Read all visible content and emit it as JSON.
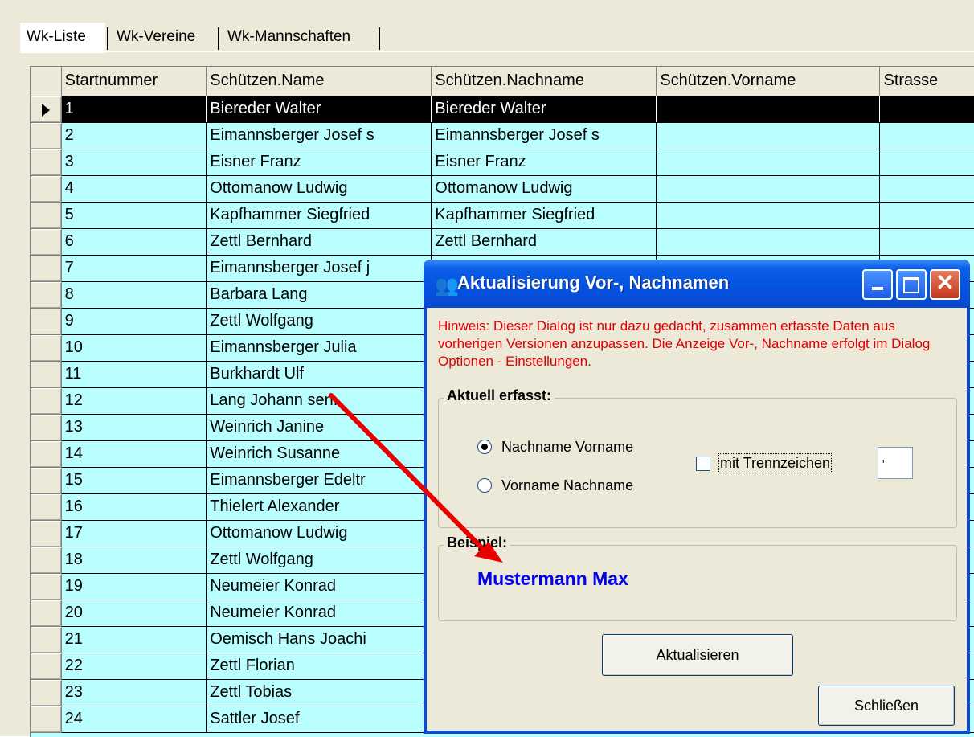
{
  "tabs": [
    "Wk-Liste",
    "Wk-Vereine",
    "Wk-Mannschaften"
  ],
  "grid": {
    "columns": [
      "Startnummer",
      "Schützen.Name",
      "Schützen.Nachname",
      "Schützen.Vorname",
      "Strasse"
    ],
    "rows": [
      {
        "nr": "1",
        "name": "Biereder Walter",
        "nachname": "Biereder Walter",
        "selected": true
      },
      {
        "nr": "2",
        "name": "Eimannsberger Josef s",
        "nachname": "Eimannsberger Josef s"
      },
      {
        "nr": "3",
        "name": "Eisner Franz",
        "nachname": "Eisner Franz"
      },
      {
        "nr": "4",
        "name": "Ottomanow Ludwig",
        "nachname": "Ottomanow Ludwig"
      },
      {
        "nr": "5",
        "name": "Kapfhammer Siegfried",
        "nachname": "Kapfhammer Siegfried"
      },
      {
        "nr": "6",
        "name": "Zettl Bernhard",
        "nachname": "Zettl Bernhard"
      },
      {
        "nr": "7",
        "name": "Eimannsberger Josef j",
        "nachname": ""
      },
      {
        "nr": "8",
        "name": "Barbara Lang",
        "nachname": ""
      },
      {
        "nr": "9",
        "name": "Zettl Wolfgang",
        "nachname": ""
      },
      {
        "nr": "10",
        "name": "Eimannsberger Julia",
        "nachname": ""
      },
      {
        "nr": "11",
        "name": "Burkhardt Ulf",
        "nachname": ""
      },
      {
        "nr": "12",
        "name": "Lang Johann sen.",
        "nachname": ""
      },
      {
        "nr": "13",
        "name": "Weinrich Janine",
        "nachname": ""
      },
      {
        "nr": "14",
        "name": "Weinrich Susanne",
        "nachname": ""
      },
      {
        "nr": "15",
        "name": "Eimannsberger Edeltr",
        "nachname": ""
      },
      {
        "nr": "16",
        "name": "Thielert Alexander",
        "nachname": ""
      },
      {
        "nr": "17",
        "name": "Ottomanow Ludwig",
        "nachname": ""
      },
      {
        "nr": "18",
        "name": "Zettl Wolfgang",
        "nachname": ""
      },
      {
        "nr": "19",
        "name": "Neumeier Konrad",
        "nachname": ""
      },
      {
        "nr": "20",
        "name": "Neumeier Konrad",
        "nachname": ""
      },
      {
        "nr": "21",
        "name": "Oemisch Hans Joachi",
        "nachname": ""
      },
      {
        "nr": "22",
        "name": "Zettl Florian",
        "nachname": ""
      },
      {
        "nr": "23",
        "name": "Zettl Tobias",
        "nachname": ""
      },
      {
        "nr": "24",
        "name": "Sattler Josef",
        "nachname": ""
      }
    ]
  },
  "dialog": {
    "title": "Aktualisierung Vor-, Nachnamen",
    "hint": "Hinweis: Dieser Dialog ist nur dazu gedacht, zusammen erfasste Daten aus vorherigen Versionen anzupassen. Die Anzeige Vor-, Nachname erfolgt im Dialog Optionen - Einstellungen.",
    "group_current_label": "Aktuell erfasst:",
    "radio_1": "Nachname Vorname",
    "radio_2": "Vorname Nachname",
    "selected_radio": 1,
    "checkbox_label": "mit Trennzeichen",
    "checkbox_checked": false,
    "separator_value": ",",
    "group_example_label": "Beispiel:",
    "example_value": "Mustermann Max",
    "update_button": "Aktualisieren",
    "close_button": "Schließen"
  },
  "colors": {
    "grid_background": "#b9ffff",
    "hint_text": "#e00000",
    "example_text": "#0000f0",
    "title_bar": "#0551e0",
    "annotation_arrow": "#e80000"
  },
  "icons": {
    "dialog_icon": "people-icon",
    "row_indicator": "row-pointer-icon"
  }
}
